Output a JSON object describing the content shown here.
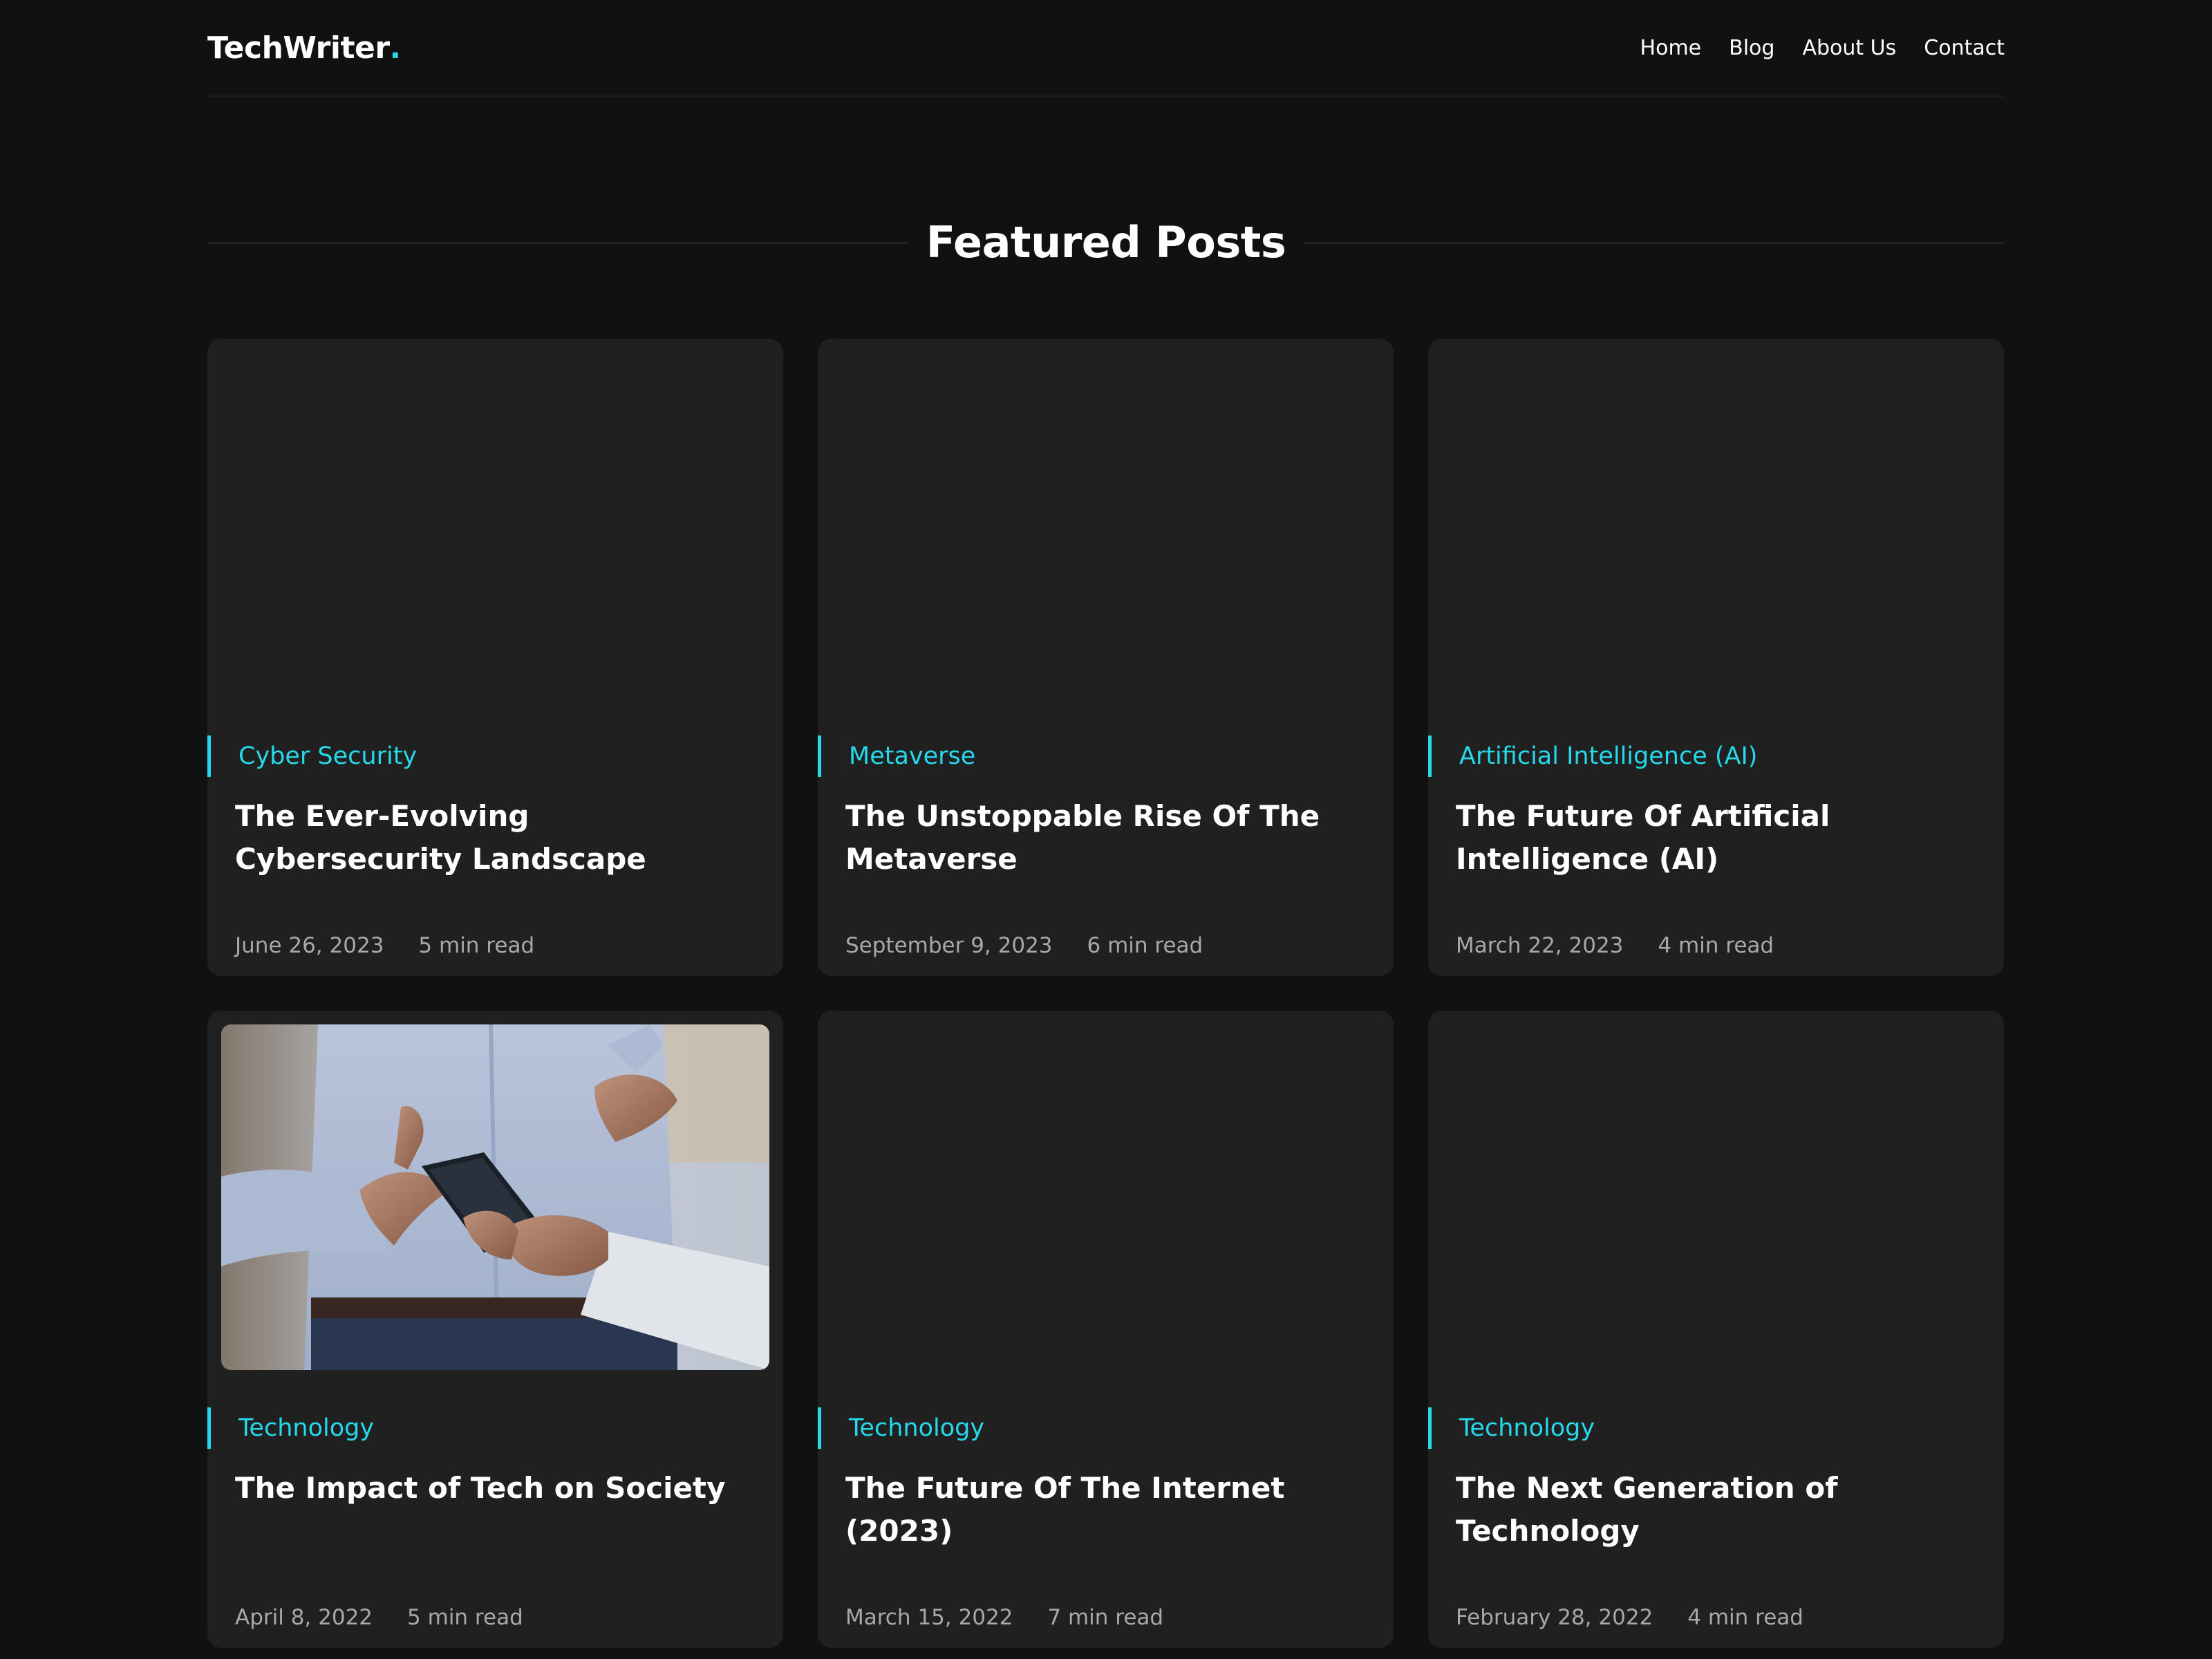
{
  "header": {
    "logo_text": "TechWriter",
    "logo_dot": ".",
    "nav": [
      {
        "label": "Home"
      },
      {
        "label": "Blog"
      },
      {
        "label": "About Us"
      },
      {
        "label": "Contact"
      }
    ]
  },
  "section": {
    "title": "Featured Posts"
  },
  "colors": {
    "accent": "#26d9ea",
    "background": "#111111",
    "card": "#202020"
  },
  "posts": [
    {
      "category": "Cyber Security",
      "title": "The Ever-Evolving Cybersecurity Landscape",
      "date": "June 26, 2023",
      "read_time": "5 min read"
    },
    {
      "category": "Metaverse",
      "title": "The Unstoppable Rise Of The Metaverse",
      "date": "September 9, 2023",
      "read_time": "6 min read"
    },
    {
      "category": "Artificial Intelligence (AI)",
      "title": "The Future Of Artificial Intelligence (AI)",
      "date": "March 22, 2023",
      "read_time": "4 min read"
    },
    {
      "category": "Technology",
      "title": "The Impact of Tech on Society",
      "date": "April 8, 2022",
      "read_time": "5 min read"
    },
    {
      "category": "Technology",
      "title": "The Future Of The Internet (2023)",
      "date": "March 15, 2022",
      "read_time": "7 min read"
    },
    {
      "category": "Technology",
      "title": "The Next Generation of Technology",
      "date": "February 28, 2022",
      "read_time": "4 min read"
    }
  ]
}
